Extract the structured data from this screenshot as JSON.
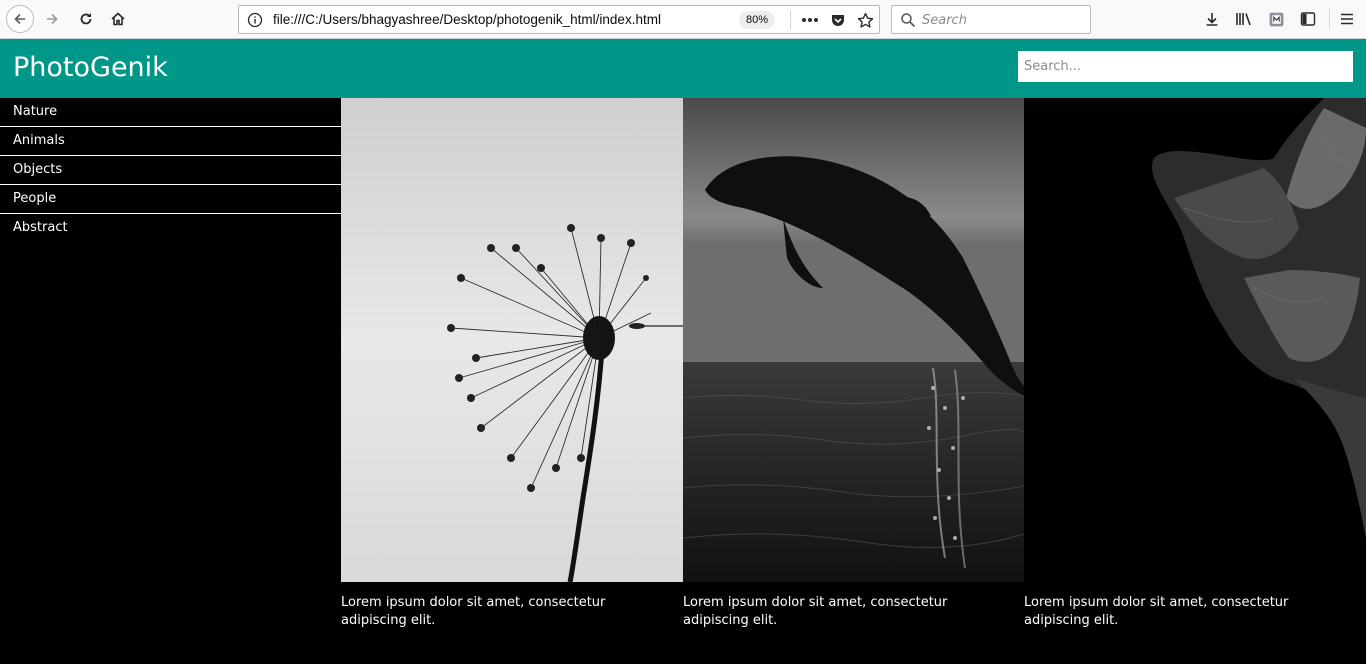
{
  "browser": {
    "url": "file:///C:/Users/bhagyashree/Desktop/photogenik_html/index.html",
    "zoom": "80%",
    "search_placeholder": "Search",
    "icons": [
      "back-icon",
      "forward-icon",
      "reload-icon",
      "home-icon",
      "info-icon",
      "more-icon",
      "pocket-icon",
      "bookmark-star-icon",
      "search-icon",
      "download-icon",
      "library-icon",
      "extension-icon",
      "sidebar-icon",
      "menu-icon"
    ]
  },
  "site": {
    "brand": "PhotoGenik",
    "search_placeholder": "Search...",
    "header_color": "#009688"
  },
  "sidebar": {
    "items": [
      {
        "label": "Nature"
      },
      {
        "label": "Animals"
      },
      {
        "label": "Objects"
      },
      {
        "label": "People"
      },
      {
        "label": "Abstract"
      }
    ]
  },
  "gallery": {
    "cards": [
      {
        "subject": "dandelion",
        "caption": "Lorem ipsum dolor sit amet, consectetur adipiscing elit."
      },
      {
        "subject": "dolphin",
        "caption": "Lorem ipsum dolor sit amet, consectetur adipiscing elit."
      },
      {
        "subject": "rose",
        "caption": "Lorem ipsum dolor sit amet, consectetur adipiscing elit."
      }
    ]
  }
}
